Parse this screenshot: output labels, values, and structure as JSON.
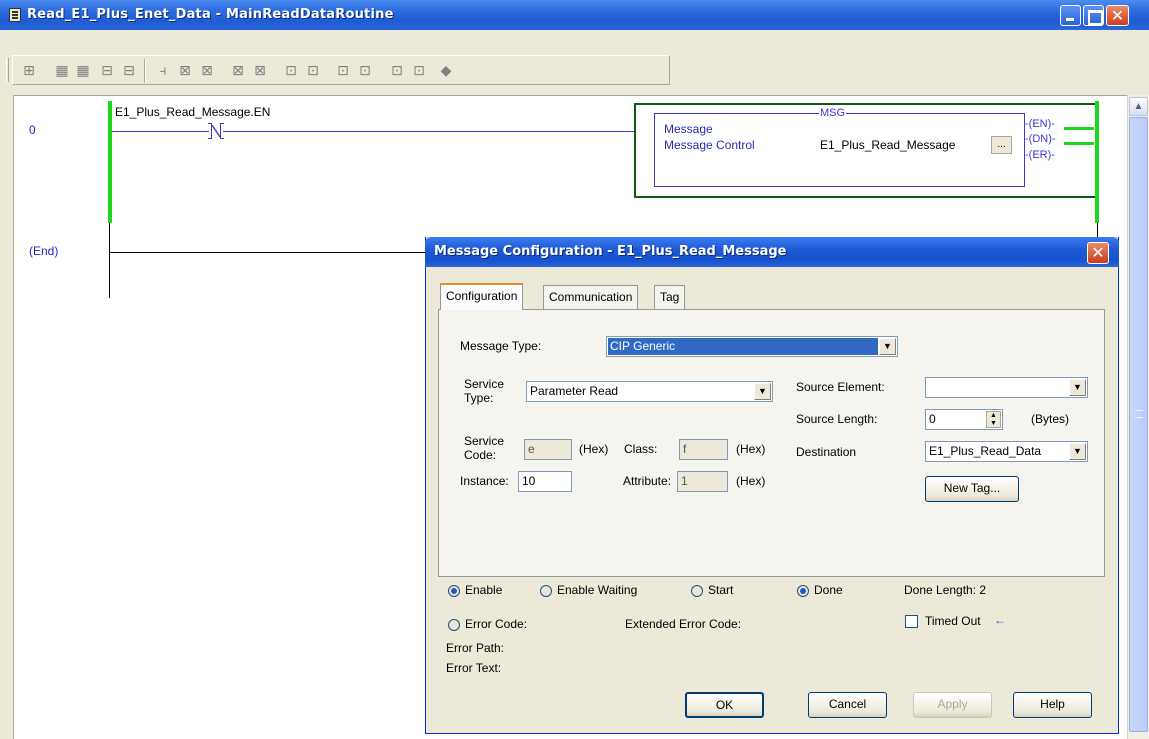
{
  "window": {
    "title": "Read_E1_Plus_Enet_Data - MainReadDataRoutine"
  },
  "ladder": {
    "rungs": [
      {
        "number": "0"
      },
      {
        "number": "(End)"
      }
    ],
    "contact": {
      "tag": "E1_Plus_Read_Message.EN",
      "type": "XIO"
    },
    "msg_block": {
      "title": "MSG",
      "row1_label": "Message",
      "row2_label": "Message Control",
      "row2_value": "E1_Plus_Read_Message",
      "ellipsis_label": "...",
      "coils": [
        "-(EN)-",
        "-(DN)-",
        "-(ER)-"
      ]
    }
  },
  "dialog": {
    "title": "Message Configuration - E1_Plus_Read_Message",
    "tabs": [
      {
        "label": "Configuration",
        "active": true
      },
      {
        "label": "Communication",
        "active": false
      },
      {
        "label": "Tag",
        "active": false
      }
    ],
    "message_type": {
      "label": "Message Type:",
      "value": "CIP Generic"
    },
    "service_type": {
      "label": "Service Type:",
      "label_line1": "Service",
      "label_line2": "Type:",
      "value": "Parameter Read"
    },
    "service_code": {
      "label_line1": "Service",
      "label_line2": "Code:",
      "value": "e",
      "unit": "(Hex)"
    },
    "class": {
      "label": "Class:",
      "value": "f",
      "unit": "(Hex)"
    },
    "instance": {
      "label": "Instance:",
      "value": "10"
    },
    "attribute": {
      "label": "Attribute:",
      "value": "1",
      "unit": "(Hex)"
    },
    "source_element": {
      "label": "Source Element:",
      "value": ""
    },
    "source_length": {
      "label": "Source Length:",
      "value": "0",
      "unit": "(Bytes)"
    },
    "destination": {
      "label": "Destination",
      "value": "E1_Plus_Read_Data"
    },
    "new_tag_label": "New Tag...",
    "status": {
      "enable": {
        "label": "Enable",
        "on": true
      },
      "enable_waiting": {
        "label": "Enable Waiting",
        "on": false
      },
      "start": {
        "label": "Start",
        "on": false
      },
      "done": {
        "label": "Done",
        "on": true
      },
      "done_length": "Done Length: 2",
      "error_code": {
        "label": "Error Code:",
        "on": false
      },
      "extended_error_code": "Extended Error Code:",
      "timed_out": {
        "label": "Timed Out",
        "checked": false,
        "arrow": "←"
      },
      "error_path": "Error Path:",
      "error_text": "Error Text:"
    },
    "buttons": {
      "ok": "OK",
      "cancel": "Cancel",
      "apply": "Apply",
      "help": "Help"
    }
  },
  "colors": {
    "title_bar": "#2c6be0",
    "rail_powered": "#1ed61e",
    "msg_outline": "#0e5a14",
    "selection": "#316ac5"
  }
}
